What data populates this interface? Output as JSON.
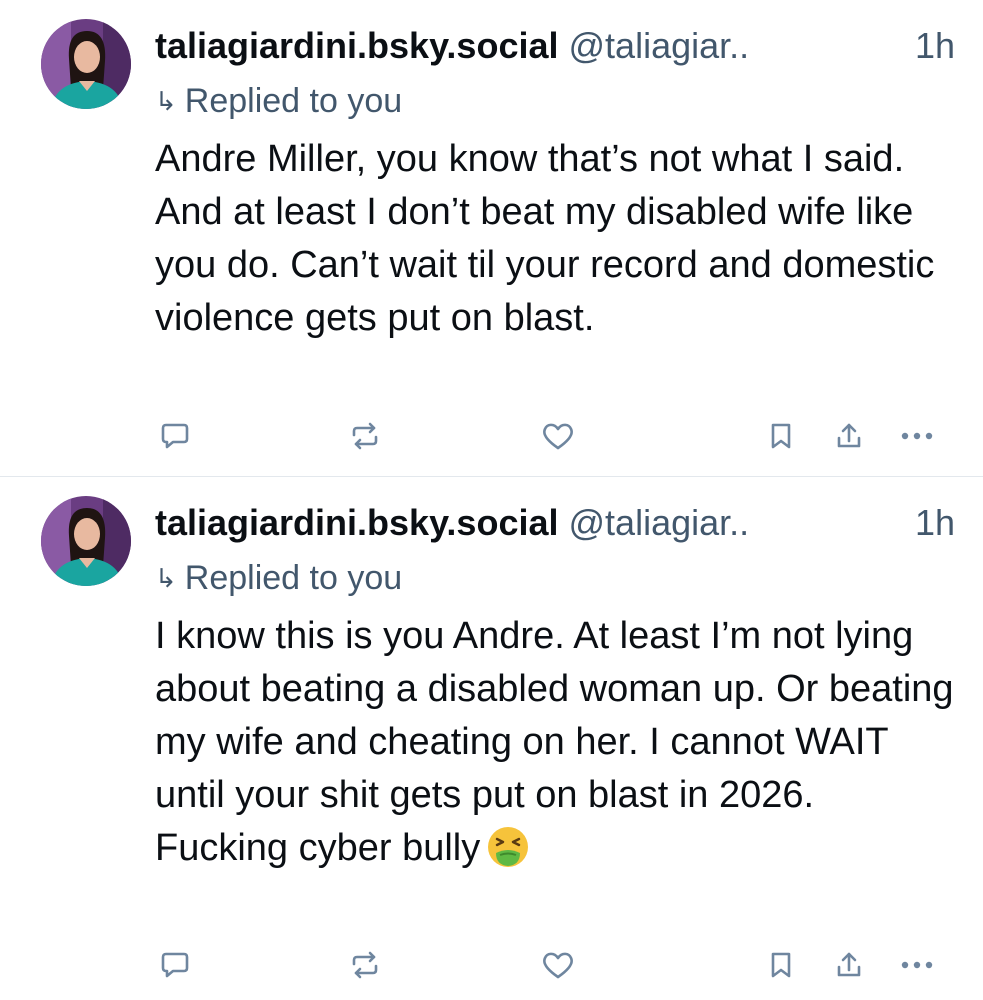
{
  "colors": {
    "text_primary": "#0b0f14",
    "text_secondary": "#42576c",
    "icon": "#6f869f",
    "divider": "#e3e8ed"
  },
  "posts": [
    {
      "display_name": "taliagiardini.bsky.social",
      "handle": "@taliagiar..",
      "time": "1h",
      "reply_label": "Replied to you",
      "text": "Andre Miller, you know that’s not what I said. And at least I don’t beat my disabled wife like you do. Can’t wait til your record and domestic violence gets put on blast.",
      "emoji": "",
      "actions": [
        "reply-icon",
        "repost-icon",
        "like-icon",
        "bookmark-icon",
        "share-icon",
        "more-icon"
      ]
    },
    {
      "display_name": "taliagiardini.bsky.social",
      "handle": "@taliagiar..",
      "time": "1h",
      "reply_label": "Replied to you",
      "text": "I know this is you Andre. At least I’m not lying about beating a disabled woman up. Or beating my wife and cheating on her. I cannot WAIT until your shit gets put on blast in 2026. Fucking cyber bully",
      "emoji": "nauseated-face-icon",
      "actions": [
        "reply-icon",
        "repost-icon",
        "like-icon",
        "bookmark-icon",
        "share-icon",
        "more-icon"
      ]
    }
  ]
}
